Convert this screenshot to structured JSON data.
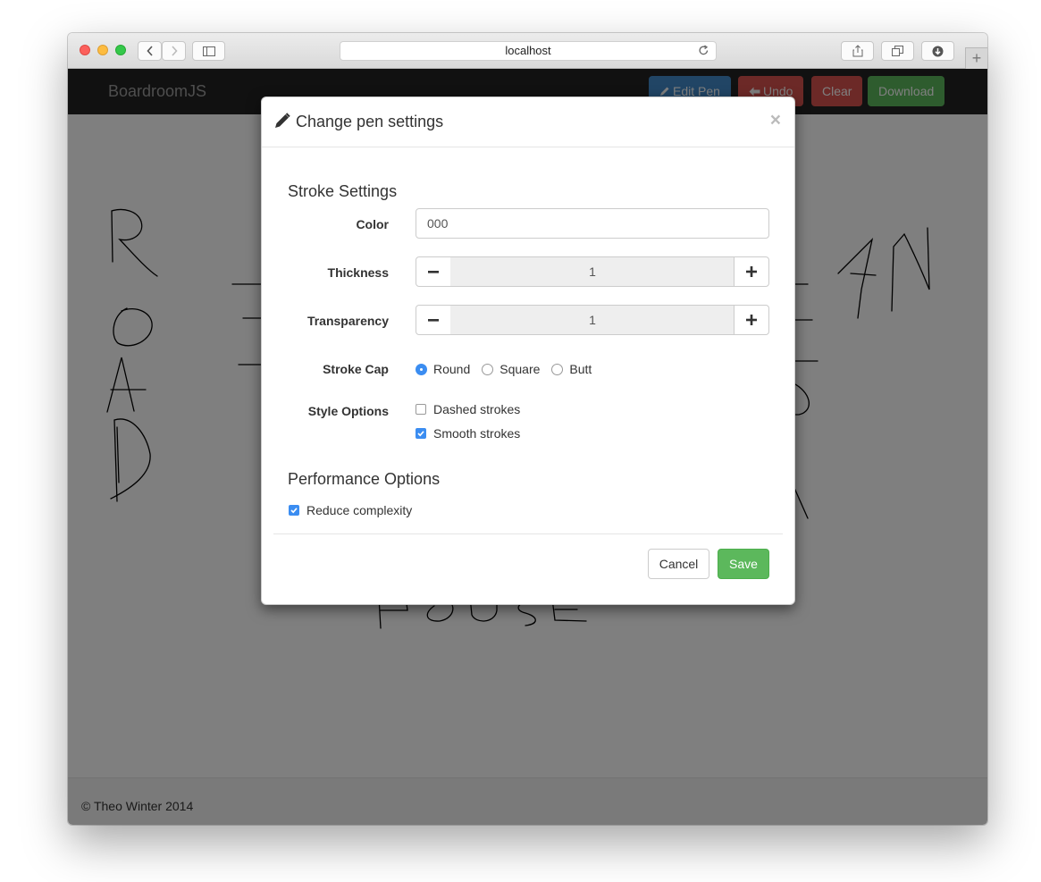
{
  "browser": {
    "address": "localhost",
    "newtab_symbol": "+"
  },
  "navbar": {
    "brand": "BoardroomJS",
    "edit_pen": "Edit Pen",
    "undo": "Undo",
    "clear": "Clear",
    "download": "Download"
  },
  "footer": {
    "copyright": "© Theo Winter 2014"
  },
  "modal": {
    "title": "Change pen settings",
    "close": "×",
    "stroke_section": "Stroke Settings",
    "color_label": "Color",
    "color_value": "000",
    "thickness_label": "Thickness",
    "thickness_value": "1",
    "transparency_label": "Transparency",
    "transparency_value": "1",
    "stroke_cap_label": "Stroke Cap",
    "stroke_caps": [
      {
        "label": "Round",
        "selected": true
      },
      {
        "label": "Square",
        "selected": false
      },
      {
        "label": "Butt",
        "selected": false
      }
    ],
    "style_options_label": "Style Options",
    "dashed_label": "Dashed strokes",
    "dashed_checked": false,
    "smooth_label": "Smooth strokes",
    "smooth_checked": true,
    "performance_section": "Performance Options",
    "reduce_label": "Reduce complexity",
    "reduce_checked": true,
    "cancel": "Cancel",
    "save": "Save"
  },
  "colors": {
    "primary": "#428bca",
    "danger": "#d9534f",
    "success": "#5cb85c",
    "checkbox_accent": "#3b8df1"
  }
}
